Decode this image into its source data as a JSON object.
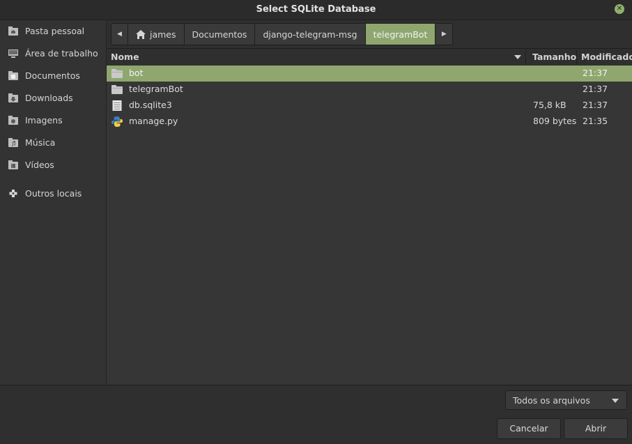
{
  "window": {
    "title": "Select SQLite Database"
  },
  "sidebar": {
    "items": [
      {
        "label": "Pasta pessoal",
        "icon": "home-folder-icon"
      },
      {
        "label": "Área de trabalho",
        "icon": "desktop-icon"
      },
      {
        "label": "Documentos",
        "icon": "documents-folder-icon"
      },
      {
        "label": "Downloads",
        "icon": "downloads-folder-icon"
      },
      {
        "label": "Imagens",
        "icon": "pictures-folder-icon"
      },
      {
        "label": "Música",
        "icon": "music-folder-icon"
      },
      {
        "label": "Vídeos",
        "icon": "videos-folder-icon"
      },
      {
        "label": "Outros locais",
        "icon": "plus-icon"
      }
    ]
  },
  "pathbar": {
    "crumbs": [
      "james",
      "Documentos",
      "django-telegram-msg",
      "telegramBot"
    ],
    "active_crumb": "telegramBot"
  },
  "filelist": {
    "columns": {
      "name": "Nome",
      "size": "Tamanho",
      "modified": "Modificado"
    },
    "rows": [
      {
        "name": "bot",
        "size": "",
        "modified": "21:37",
        "icon": "folder-icon",
        "selected": true
      },
      {
        "name": "telegramBot",
        "size": "",
        "modified": "21:37",
        "icon": "folder-icon",
        "selected": false
      },
      {
        "name": "db.sqlite3",
        "size": "75,8 kB",
        "modified": "21:37",
        "icon": "database-file-icon",
        "selected": false
      },
      {
        "name": "manage.py",
        "size": "809 bytes",
        "modified": "21:35",
        "icon": "python-file-icon",
        "selected": false
      }
    ]
  },
  "filter": {
    "selected": "Todos os arquivos"
  },
  "buttons": {
    "cancel": "Cancelar",
    "open": "Abrir"
  },
  "colors": {
    "accent": "#8fa76e",
    "background": "#2f2f2f"
  }
}
